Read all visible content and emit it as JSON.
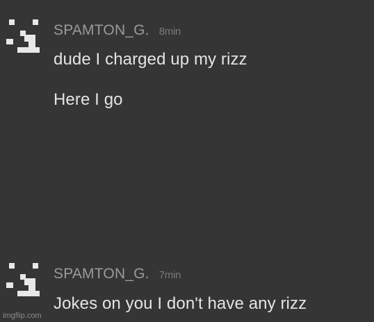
{
  "messages": [
    {
      "username": "SPAMTON_G.",
      "time": "8min",
      "lines": [
        "dude I charged up my rizz",
        "Here I go"
      ],
      "avatar_icon": "pixel-face-icon"
    },
    {
      "username": "SPAMTON_G.",
      "time": "7min",
      "lines": [
        "Jokes on you I don't have any rizz"
      ],
      "avatar_icon": "pixel-face-icon"
    }
  ],
  "watermark": "imgflip.com",
  "colors": {
    "background": "#353535",
    "text": "#e4e4e4",
    "username": "#9a9a9a",
    "timestamp": "#7a7a7a",
    "avatar": "#e8e8e8"
  }
}
